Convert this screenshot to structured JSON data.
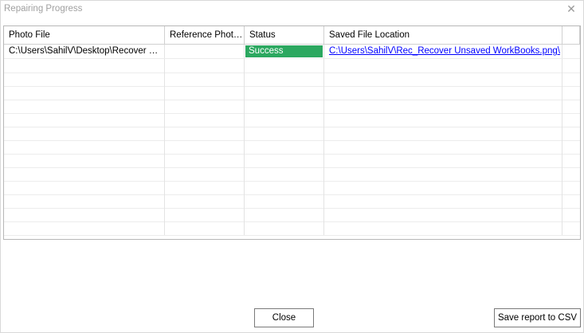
{
  "window": {
    "title": "Repairing Progress",
    "close_glyph": "✕",
    "close_icon": "close-icon"
  },
  "table": {
    "columns": [
      "Photo File",
      "Reference Photo...",
      "Status",
      "Saved File Location"
    ],
    "rows": [
      {
        "photo_file": "C:\\Users\\SahilV\\Desktop\\Recover Un...",
        "reference_photo": "",
        "status": "Success",
        "saved_location": "C:\\Users\\SahilV\\Rec_Recover Unsaved WorkBooks.png\\"
      }
    ],
    "empty_row_count": 13,
    "status_success_color": "#2ca860",
    "link_color": "#0000ff"
  },
  "buttons": {
    "close_label": "Close",
    "save_csv_label": "Save report to CSV"
  }
}
